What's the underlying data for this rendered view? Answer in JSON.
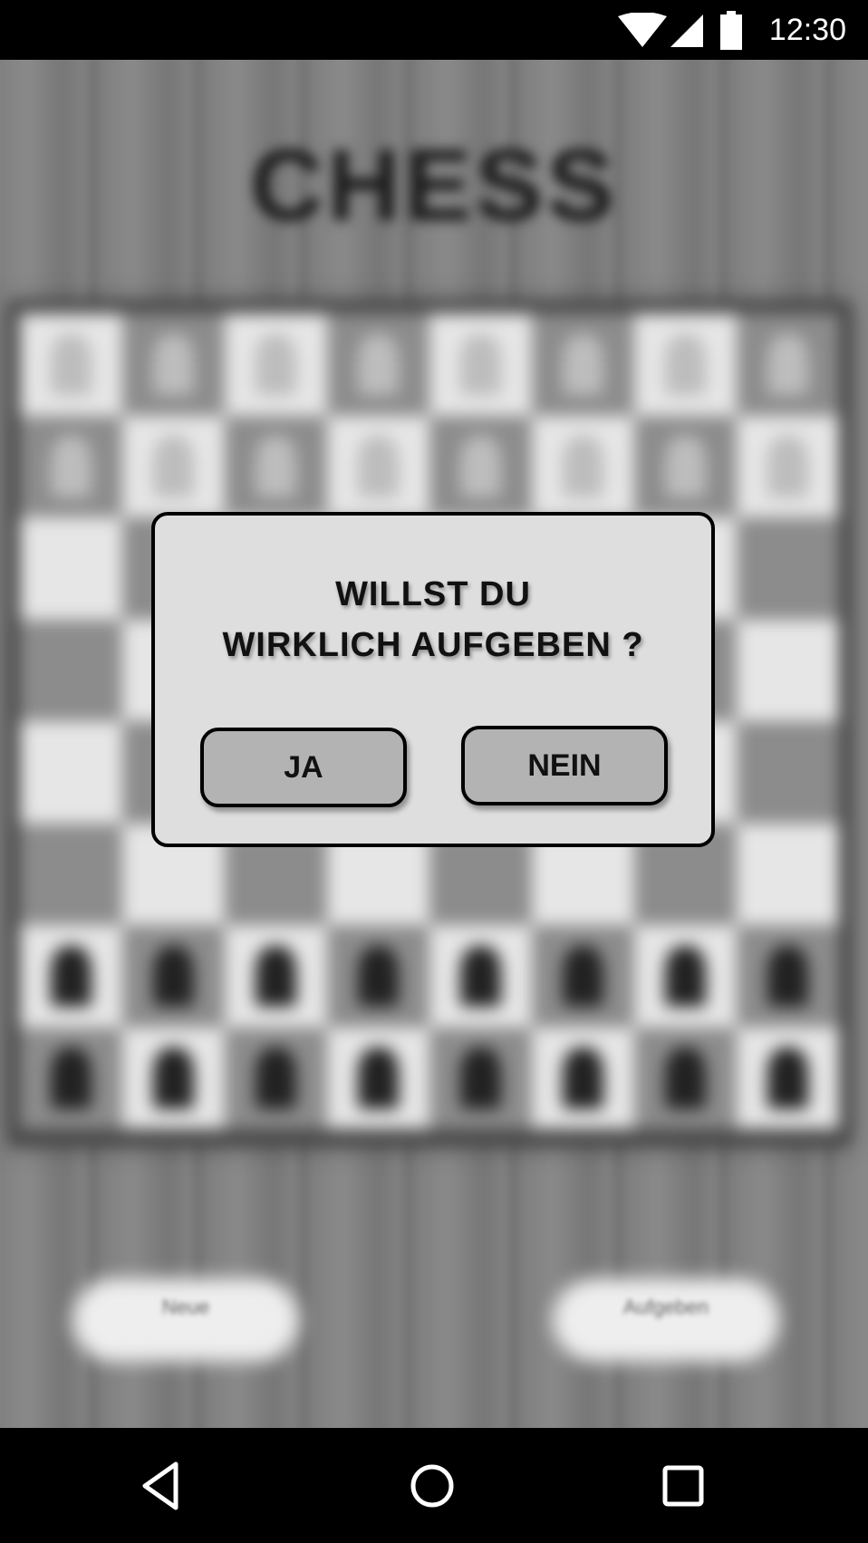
{
  "status_bar": {
    "time": "12:30",
    "icons": [
      "wifi-icon",
      "cell-signal-icon",
      "battery-icon"
    ]
  },
  "background": {
    "title": "CHESS",
    "left_button_label": "Neue",
    "right_button_label": "Aufgeben"
  },
  "dialog": {
    "message_line1": "WILLST DU",
    "message_line2": "WIRKLICH AUFGEBEN ?",
    "yes_label": "JA",
    "no_label": "NEIN"
  },
  "nav_bar": {
    "icons": [
      "back-icon",
      "home-icon",
      "recents-icon"
    ]
  },
  "colors": {
    "status_bar": "#000000",
    "dialog_background": "#dedede",
    "dialog_button": "#b3b3b3",
    "nav_bar": "#000000"
  }
}
